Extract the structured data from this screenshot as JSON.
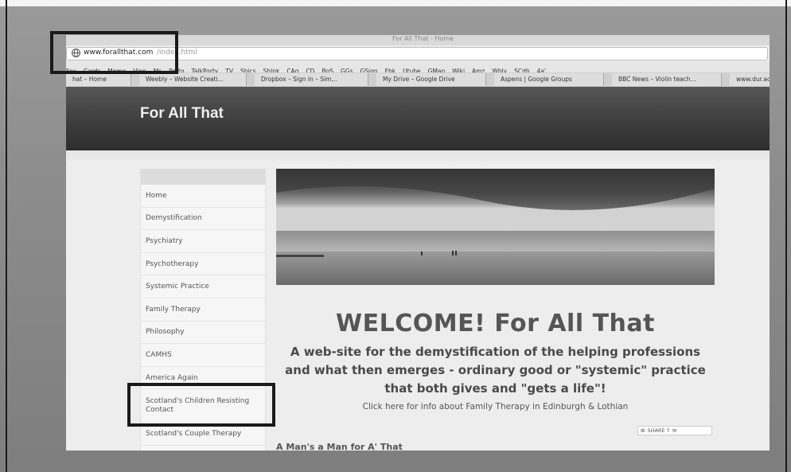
{
  "browser": {
    "window_title": "For All That - Home",
    "url_host": "www.forallthat.com",
    "url_path": "/index.html",
    "bookmarks": [
      "Fox",
      "Cards",
      "Memo",
      "Vien",
      "Ms",
      "Porto",
      "TalkPorty",
      "TV",
      "Shics",
      "Shlnk",
      "CAg",
      "CD",
      "BoS",
      "GGs",
      "GSign",
      "Fbk",
      "Utube",
      "GMap",
      "Wiki",
      "Amz",
      "Wbly",
      "SCdh",
      "4a'"
    ],
    "tabs": [
      "hat – Home",
      "Weebly – Website Creati...",
      "Dropbox – Sign in – Sim...",
      "My Drive – Google Drive",
      "Aspens | Google Groups",
      "BBC News – Violin teach...",
      "www.dur.ac.u"
    ]
  },
  "site": {
    "title": "For All That",
    "nav": [
      "Home",
      "Demystification",
      "Psychiatry",
      "Psychotherapy",
      "Systemic Practice",
      "Family Therapy",
      "Philosophy",
      "CAMHS",
      "America Again",
      "Scotland's Children Resisting Contact",
      "Scotland's Couple Therapy"
    ],
    "welcome": "WELCOME!  For All That",
    "subtitle_lines": [
      "A web-site for the demystification of the helping professions",
      "and what then emerges - ordinary good or \"systemic\" practice",
      "that both gives and \"gets a life\"!"
    ],
    "info_link": "Click here for info about Family Therapy in Edinburgh & Lothian",
    "share_label": "SHARE",
    "section_heading": "A Man's a Man for A' That"
  }
}
